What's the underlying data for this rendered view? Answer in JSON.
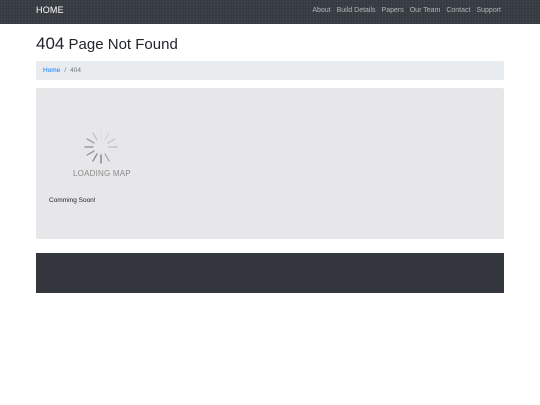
{
  "navbar": {
    "brand": "HOME",
    "links": [
      "About",
      "Build Details",
      "Papers",
      "Our Team",
      "Contact",
      "Support"
    ]
  },
  "page": {
    "code": "404",
    "title": "Page Not Found"
  },
  "breadcrumb": {
    "home": "Home",
    "separator": "/",
    "current": "404"
  },
  "map": {
    "loading_text": "LOADING MAP",
    "message": "Comming Soon!"
  },
  "colors": {
    "navbar_bg": "#343a40",
    "link_blue": "#007bff",
    "panel_bg": "#e7e7ea",
    "footer_bg": "#33363d"
  }
}
